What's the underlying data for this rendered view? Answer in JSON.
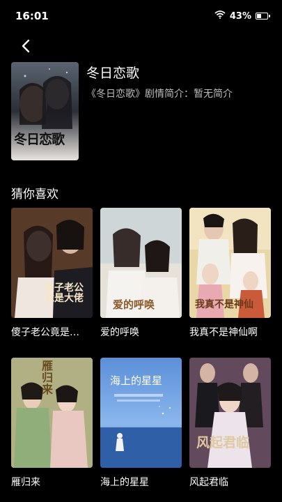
{
  "status": {
    "time": "16:01",
    "battery": "43%",
    "battery_level": 0.43
  },
  "icons": {
    "back": "chevron-left-icon",
    "wifi": "wifi-icon",
    "battery": "battery-icon"
  },
  "drama": {
    "title": "冬日恋歌",
    "description": "《冬日恋歌》剧情简介：暂无简介",
    "poster_text": "冬日恋歌"
  },
  "section": {
    "title": "猜你喜欢"
  },
  "recommendations": [
    {
      "label": "傻子老公竟是…",
      "poster_text": "傻子老公竟是大佬"
    },
    {
      "label": "爱的呼唤",
      "poster_text": "爱的呼唤"
    },
    {
      "label": "我真不是神仙啊",
      "poster_text": "我真不是神仙"
    },
    {
      "label": "雁归来",
      "poster_text": "雁归来"
    },
    {
      "label": "海上的星星",
      "poster_text": "海上的星星"
    },
    {
      "label": "风起君临",
      "poster_text": "风起君临"
    }
  ]
}
